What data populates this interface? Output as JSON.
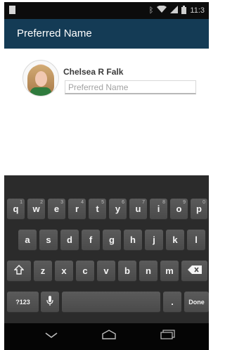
{
  "status_bar": {
    "time": "11:3"
  },
  "app_bar": {
    "title": "Preferred Name"
  },
  "profile": {
    "name": "Chelsea R Falk",
    "preferred_name_value": "",
    "preferred_name_placeholder": "Preferred Name"
  },
  "keyboard": {
    "row1": [
      "q",
      "w",
      "e",
      "r",
      "t",
      "y",
      "u",
      "i",
      "o",
      "p"
    ],
    "row1_hints": [
      "1",
      "2",
      "3",
      "4",
      "5",
      "6",
      "7",
      "8",
      "9",
      "0"
    ],
    "row2": [
      "a",
      "s",
      "d",
      "f",
      "g",
      "h",
      "j",
      "k",
      "l"
    ],
    "row3": [
      "z",
      "x",
      "c",
      "v",
      "b",
      "n",
      "m"
    ],
    "symbols_label": "?123",
    "period_label": ".",
    "done_label": "Done"
  },
  "icons": {
    "shift": "shift-icon",
    "backspace": "backspace-icon",
    "mic": "microphone-icon",
    "back": "back-icon",
    "home": "home-icon",
    "recents": "recents-icon"
  }
}
